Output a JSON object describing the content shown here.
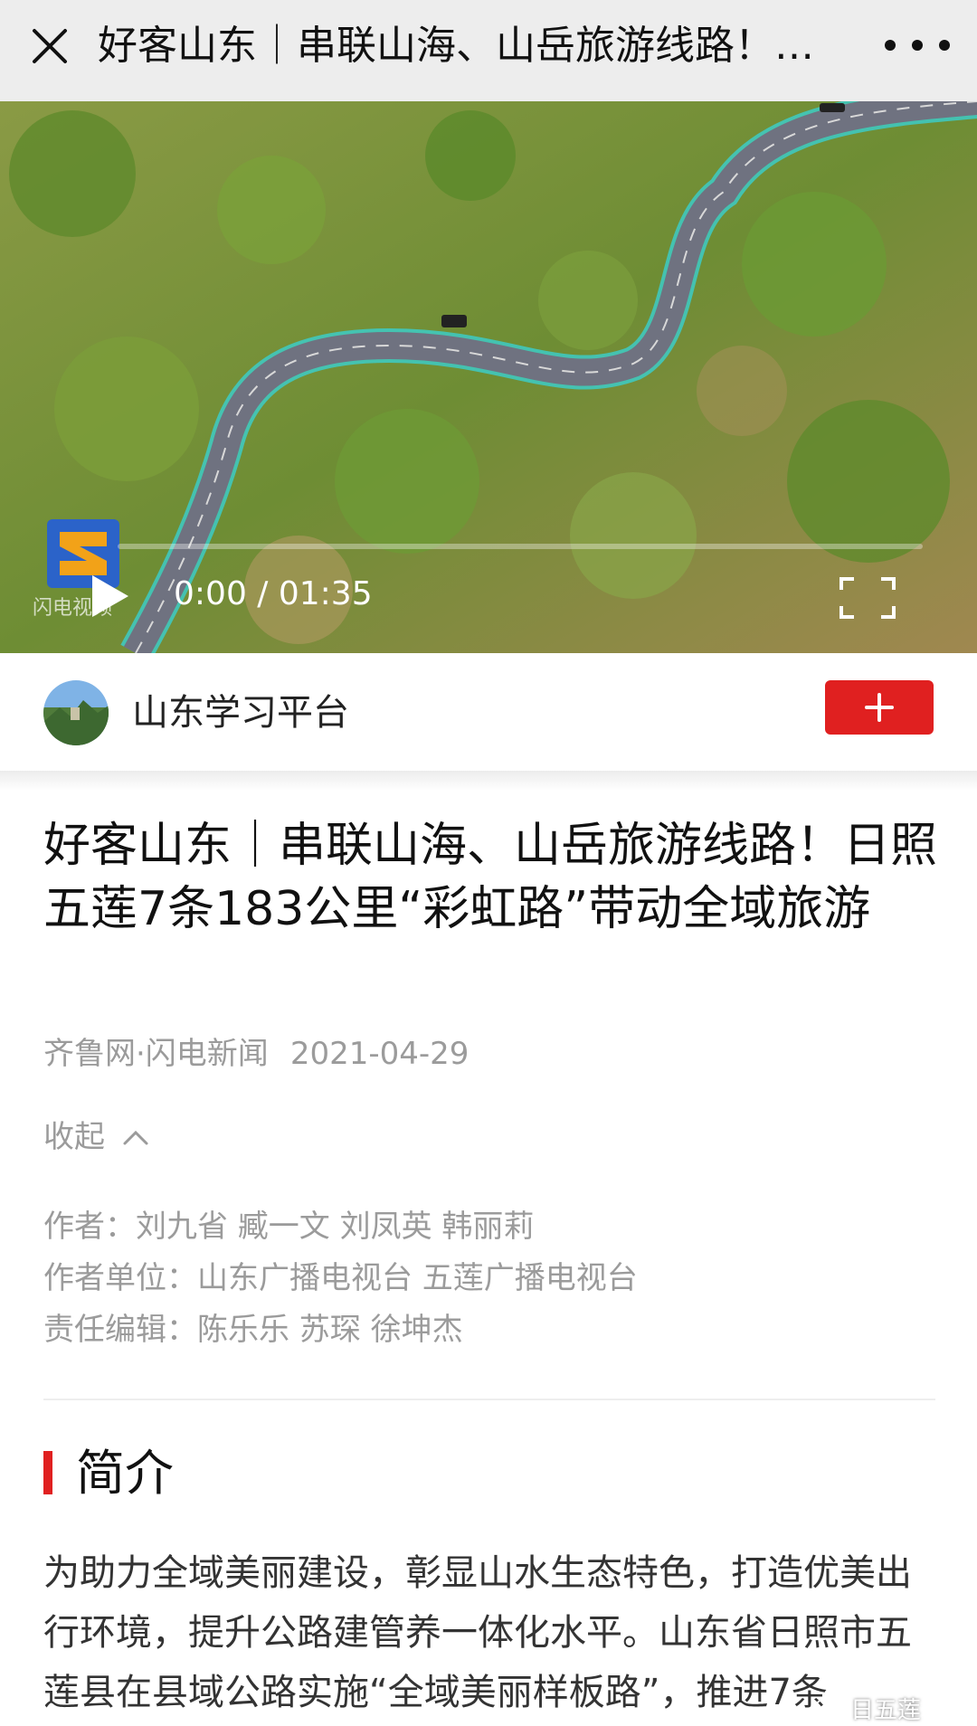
{
  "topbar": {
    "title": "好客山东｜串联山海、山岳旅游线路！日照五莲7条183公里“彩虹路”带动全域旅游",
    "close_icon": "close-icon",
    "more_icon": "more-dots-icon"
  },
  "video": {
    "time": "0:00 / 01:35",
    "progress": 0,
    "channel_watermark": "闪电视频"
  },
  "publisher": {
    "name": "山东学习平台",
    "follow_icon": "plus-icon",
    "follow_color": "#e02020"
  },
  "article": {
    "title": "好客山东｜串联山海、山岳旅游线路！日照五莲7条183公里“彩虹路”带动全域旅游",
    "source": "齐鲁网·闪电新闻",
    "date": "2021-04-29",
    "collapse_label": "收起",
    "credits": {
      "authors": "作者：刘九省 臧一文 刘凤英 韩丽莉",
      "units": "作者单位：山东广播电视台 五莲广播电视台",
      "editors": "责任编辑：陈乐乐 苏琛 徐坤杰"
    },
    "section_title": "简介",
    "intro": "为助力全域美丽建设，彰显山水生态特色，打造优美出行环境，提升公路建管养一体化水平。山东省日照市五莲县在县域公路实施“全域美丽样板路”，推进7条",
    "watermark": "日五莲"
  },
  "colors": {
    "accent_red": "#e02020",
    "topbar_bg": "#ededed",
    "meta_gray": "#9b9b9b"
  }
}
